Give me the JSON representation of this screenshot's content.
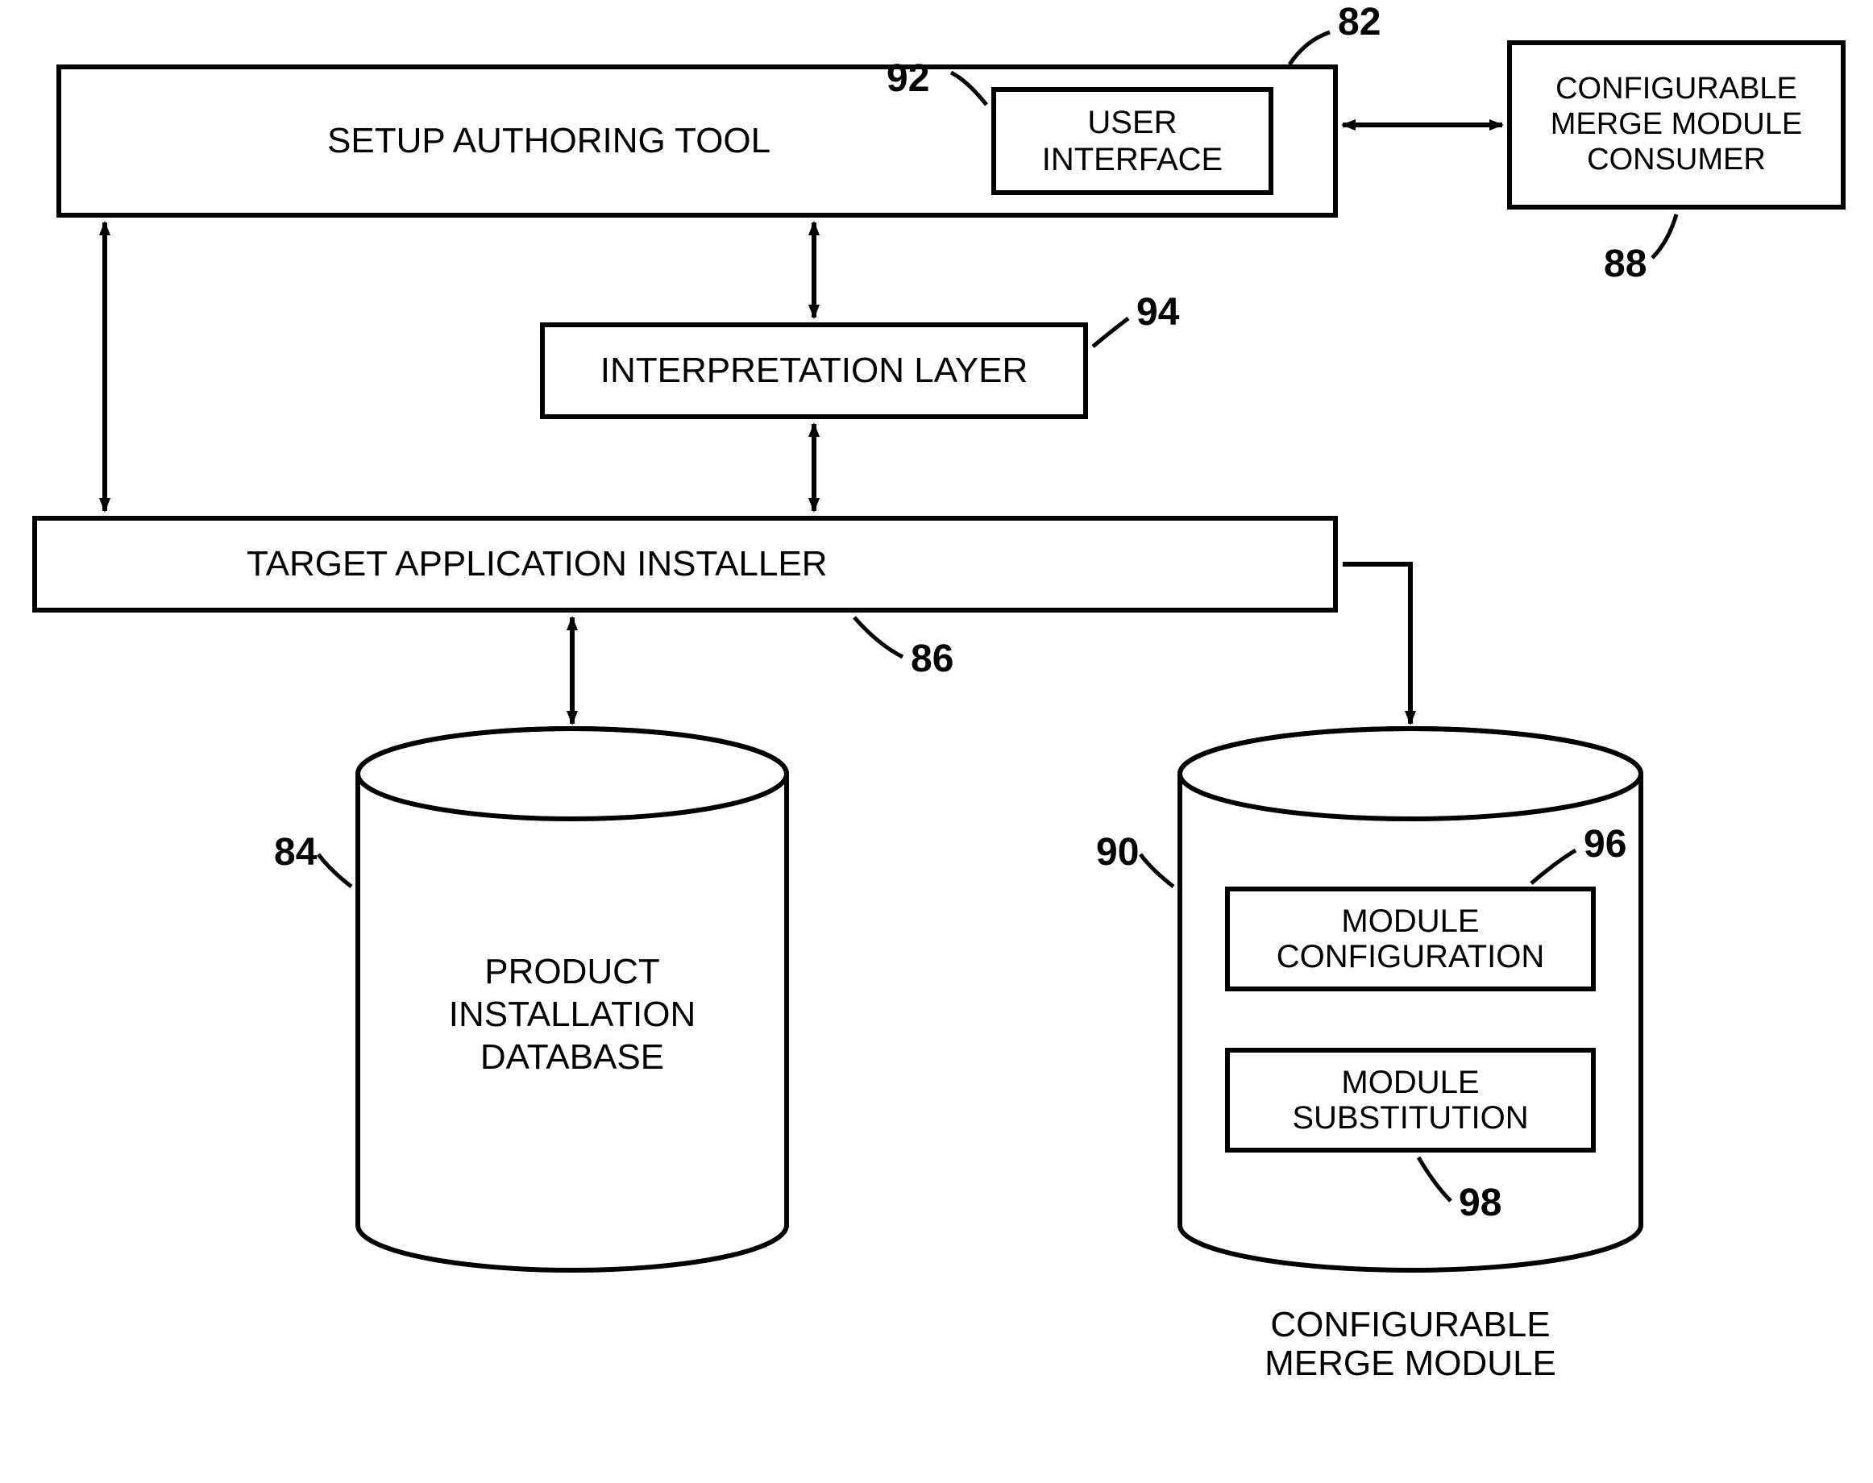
{
  "boxes": {
    "setup_tool": {
      "label": "SETUP AUTHORING TOOL"
    },
    "user_interface": {
      "label": "USER\nINTERFACE"
    },
    "consumer": {
      "label": "CONFIGURABLE\nMERGE MODULE\nCONSUMER"
    },
    "interp": {
      "label": "INTERPRETATION LAYER"
    },
    "installer": {
      "label": "TARGET APPLICATION INSTALLER"
    }
  },
  "cyl_left": {
    "label": "PRODUCT\nINSTALLATION\nDATABASE"
  },
  "cyl_right": {
    "caption": "CONFIGURABLE\nMERGE MODULE",
    "module_config": "MODULE\nCONFIGURATION",
    "module_sub": "MODULE\nSUBSTITUTION"
  },
  "refs": {
    "r82": "82",
    "r84": "84",
    "r86": "86",
    "r88": "88",
    "r90": "90",
    "r92": "92",
    "r94": "94",
    "r96": "96",
    "r98": "98"
  }
}
